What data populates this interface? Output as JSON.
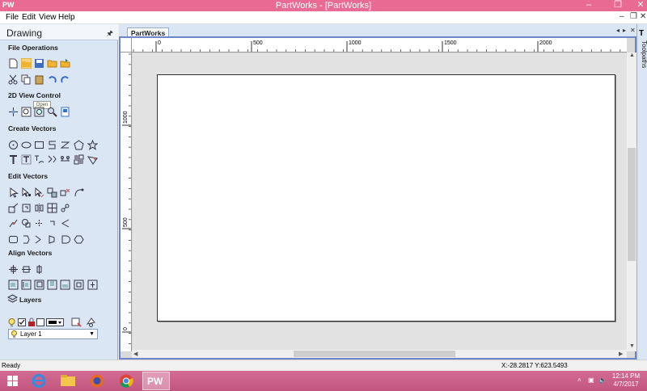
{
  "window": {
    "app_icon": "PW",
    "title": "PartWorks - [PartWorks]",
    "minimize_icon": "minimize-icon",
    "restore_icon": "restore-icon",
    "close_icon": "close-icon"
  },
  "menu": {
    "items": [
      "File",
      "Edit",
      "View",
      "Help"
    ]
  },
  "panel": {
    "title": "Drawing",
    "pin_icon": "pin-icon",
    "sections": {
      "file_operations": "File Operations",
      "view_control": "2D View Control",
      "create_vectors": "Create Vectors",
      "edit_vectors": "Edit Vectors",
      "align_vectors": "Align Vectors",
      "layers": "Layers"
    },
    "tooltip": "Open",
    "layer": {
      "selected": "Layer 1"
    }
  },
  "document": {
    "tab": "PartWorks",
    "ruler_h_labels": [
      "0",
      "500",
      "1000",
      "1500",
      "2000"
    ],
    "ruler_v_labels": [
      "1000",
      "500",
      "0"
    ]
  },
  "right_panel": {
    "label": "Toolpaths"
  },
  "status": {
    "text": "Ready",
    "coords": "X:-28.2817 Y:623.5493"
  },
  "taskbar": {
    "active_app": "PW",
    "time": "12:14 PM",
    "date": "4/7/2017"
  },
  "colors": {
    "title_bar": "#e96a93",
    "panel_bg": "#dbe6f4",
    "doc_border": "#6d86c7",
    "taskbar": "#c95c85"
  }
}
